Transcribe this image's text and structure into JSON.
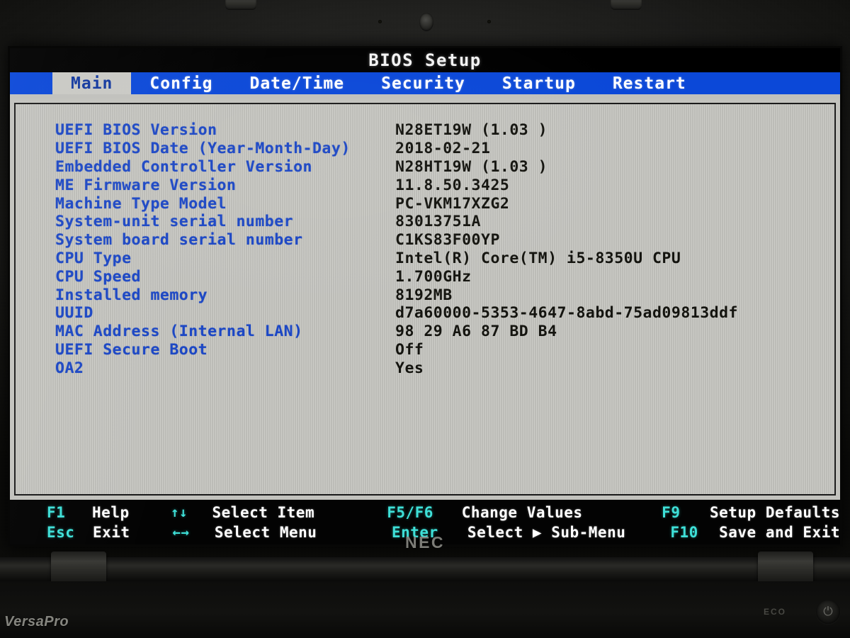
{
  "screen": {
    "title": "BIOS Setup",
    "tabs": [
      {
        "label": "Main",
        "active": true
      },
      {
        "label": "Config",
        "active": false
      },
      {
        "label": "Date/Time",
        "active": false
      },
      {
        "label": "Security",
        "active": false
      },
      {
        "label": "Startup",
        "active": false
      },
      {
        "label": "Restart",
        "active": false
      }
    ],
    "main_rows": [
      {
        "label": "UEFI BIOS Version",
        "value": "N28ET19W (1.03 )"
      },
      {
        "label": "UEFI BIOS Date (Year-Month-Day)",
        "value": "2018-02-21"
      },
      {
        "label": "Embedded Controller Version",
        "value": "N28HT19W (1.03 )"
      },
      {
        "label": "ME Firmware Version",
        "value": "11.8.50.3425"
      },
      {
        "label": "Machine Type Model",
        "value": "PC-VKM17XZG2"
      },
      {
        "label": "System-unit serial number",
        "value": "83013751A"
      },
      {
        "label": "System board serial number",
        "value": "C1KS83F00YP"
      },
      {
        "label": "CPU Type",
        "value": "Intel(R) Core(TM) i5-8350U CPU"
      },
      {
        "label": "CPU Speed",
        "value": "1.700GHz"
      },
      {
        "label": "Installed memory",
        "value": "8192MB"
      },
      {
        "label": "UUID",
        "value": "d7a60000-5353-4647-8abd-75ad09813ddf"
      },
      {
        "label": "MAC Address (Internal LAN)",
        "value": "98 29 A6 87 BD B4"
      },
      {
        "label": "UEFI Secure Boot",
        "value": "Off"
      },
      {
        "label": "OA2",
        "value": "Yes"
      }
    ],
    "footer": {
      "row1": {
        "key1": "F1",
        "desc1": "Help",
        "key2": "↑↓",
        "desc2": "Select Item",
        "key3": "F5/F6",
        "desc3": "Change Values",
        "key4": "F9",
        "desc4": "Setup Defaults"
      },
      "row2": {
        "key1": "Esc",
        "desc1": "Exit",
        "key2": "←→",
        "desc2": "Select Menu",
        "key3": "Enter",
        "desc3": "Select ▶ Sub-Menu",
        "key4": "F10",
        "desc4": "Save and Exit"
      }
    }
  },
  "hardware": {
    "bezel_brand": "NEC",
    "base_brand": "VersaPro",
    "eco_label": "ECO",
    "power_glyph": "⏻"
  },
  "colors": {
    "tabbar_blue": "#0b48d8",
    "label_blue": "#1c47c4",
    "key_cyan": "#3ee0d8",
    "panel_gray": "#c6c6c1",
    "active_tab_gray": "#c9c9c4"
  }
}
